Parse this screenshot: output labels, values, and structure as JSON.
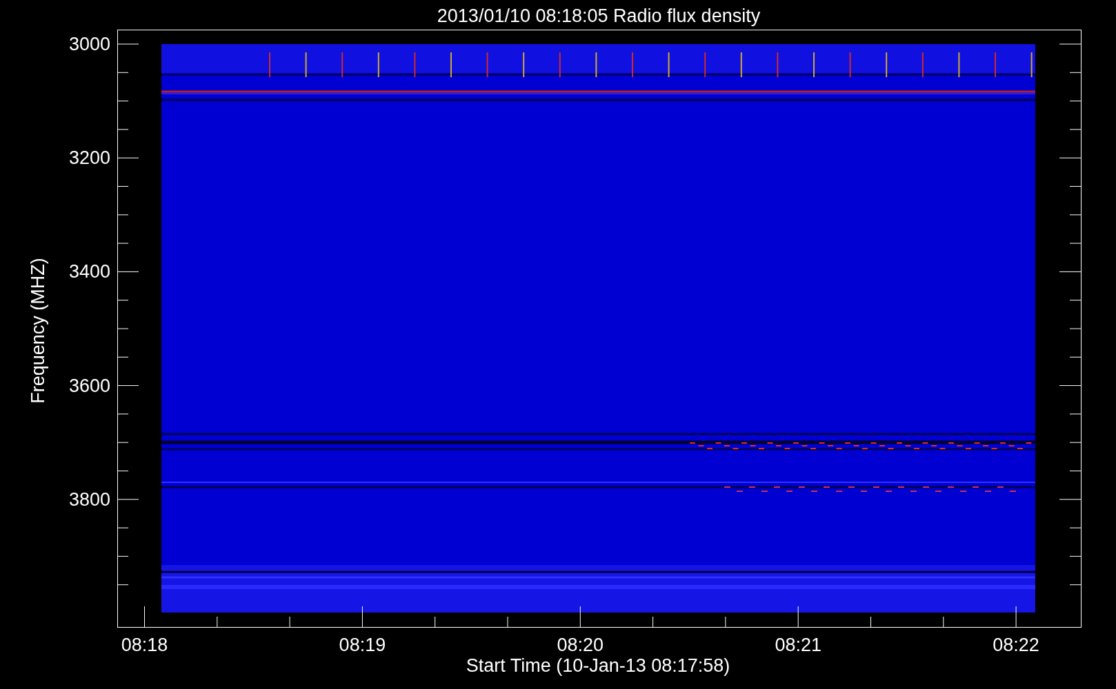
{
  "title": "2013/01/10 08:18:05 Radio flux density",
  "y_axis": {
    "label": "Frequency (MHZ)",
    "ticks": [
      "3000",
      "3200",
      "3400",
      "3600",
      "3800"
    ]
  },
  "x_axis": {
    "label": "Start Time (10-Jan-13 08:17:58)",
    "ticks": [
      "08:18",
      "08:19",
      "08:20",
      "08:21",
      "08:22"
    ]
  }
}
